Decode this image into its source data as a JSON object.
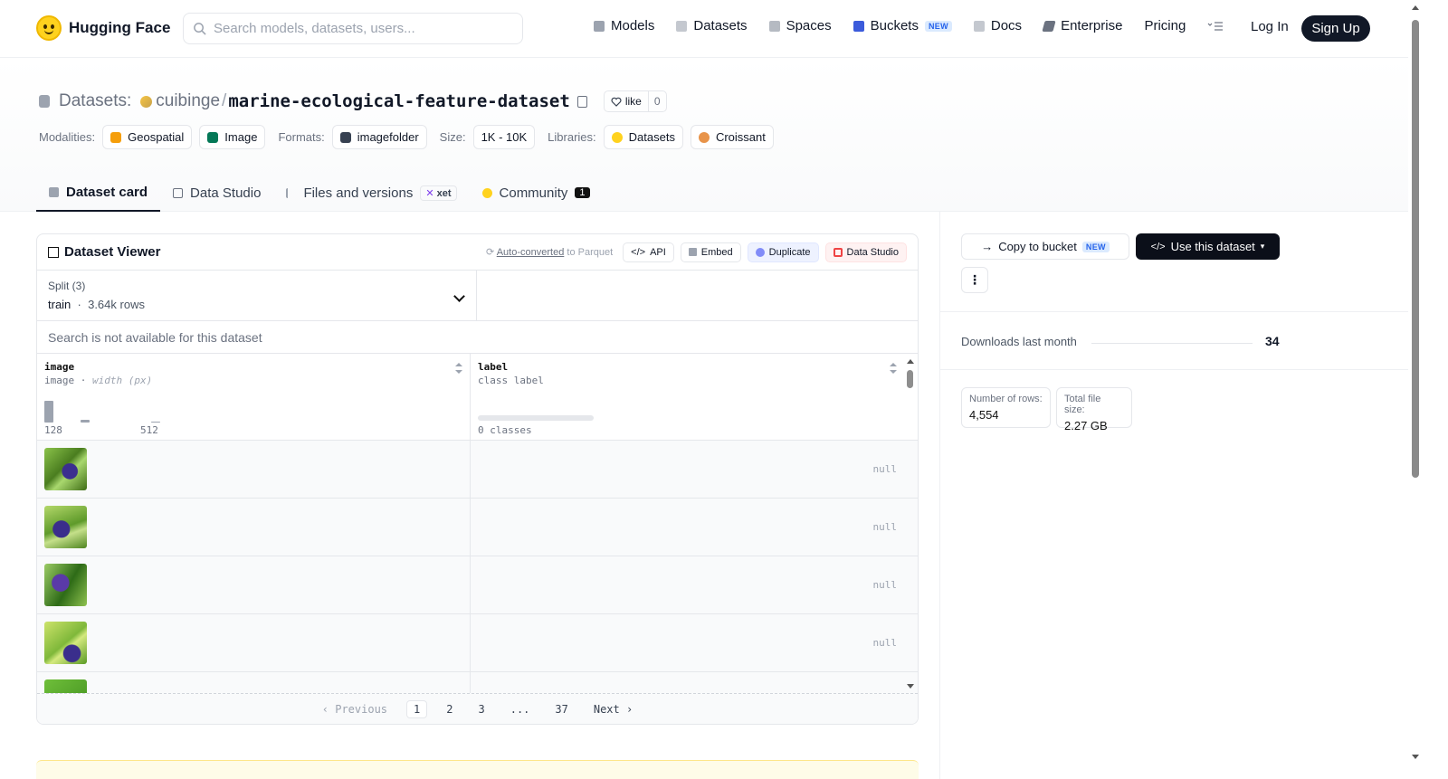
{
  "brand": {
    "name": "Hugging Face"
  },
  "search": {
    "placeholder": "Search models, datasets, users..."
  },
  "nav": {
    "items": [
      {
        "label": "Models",
        "icon": "cube-icon",
        "color": "#9ca3af"
      },
      {
        "label": "Datasets",
        "icon": "database-icon",
        "color": "#9ca3af"
      },
      {
        "label": "Spaces",
        "icon": "grid-icon",
        "color": "#9ca3af"
      },
      {
        "label": "Buckets",
        "icon": "bucket-icon",
        "color": "#3b5bdb",
        "badge": "NEW"
      },
      {
        "label": "Docs",
        "icon": "book-icon",
        "color": "#9ca3af"
      },
      {
        "label": "Enterprise",
        "icon": "enterprise-icon",
        "color": "#6b7280"
      },
      {
        "label": "Pricing"
      }
    ],
    "login": "Log In",
    "signup": "Sign Up"
  },
  "repo": {
    "kind": "Datasets:",
    "org": "cuibinge",
    "name": "marine-ecological-feature-dataset",
    "like_label": "like",
    "like_count": "0"
  },
  "tags": {
    "modalities_label": "Modalities:",
    "modalities": [
      "Geospatial",
      "Image"
    ],
    "formats_label": "Formats:",
    "formats": [
      "imagefolder"
    ],
    "size_label": "Size:",
    "size": "1K - 10K",
    "libraries_label": "Libraries:",
    "libraries": [
      "Datasets",
      "Croissant"
    ]
  },
  "tabs": {
    "card": "Dataset card",
    "studio": "Data Studio",
    "files": "Files and versions",
    "xet": "xet",
    "community": "Community",
    "community_count": "1"
  },
  "viewer": {
    "title": "Dataset Viewer",
    "auto_converted": "Auto-converted",
    "to_parquet": "to Parquet",
    "api": "API",
    "embed": "Embed",
    "duplicate": "Duplicate",
    "data_studio": "Data Studio",
    "split_label": "Split (3)",
    "split_value": "train",
    "split_rows": "3.64k rows",
    "search_placeholder": "Search is not available for this dataset",
    "columns": [
      {
        "name": "image",
        "type": "image",
        "subtype": "width (px)",
        "hist_min": "128",
        "hist_max": "512"
      },
      {
        "name": "label",
        "type": "class label",
        "classes": "0 classes"
      }
    ],
    "rows": [
      {
        "label": "null"
      },
      {
        "label": "null"
      },
      {
        "label": "null"
      },
      {
        "label": "null"
      },
      {
        "label": ""
      }
    ],
    "pager": {
      "prev": "Previous",
      "pages": [
        "1",
        "2",
        "3",
        "...",
        "37"
      ],
      "next": "Next",
      "current": "1"
    }
  },
  "side": {
    "copy_bucket": "Copy to bucket",
    "copy_badge": "NEW",
    "use_dataset": "Use this dataset",
    "downloads_label": "Downloads last month",
    "downloads_value": "34",
    "rows_label": "Number of rows:",
    "rows_value": "4,554",
    "size_label": "Total file size:",
    "size_value": "2.27 GB"
  }
}
